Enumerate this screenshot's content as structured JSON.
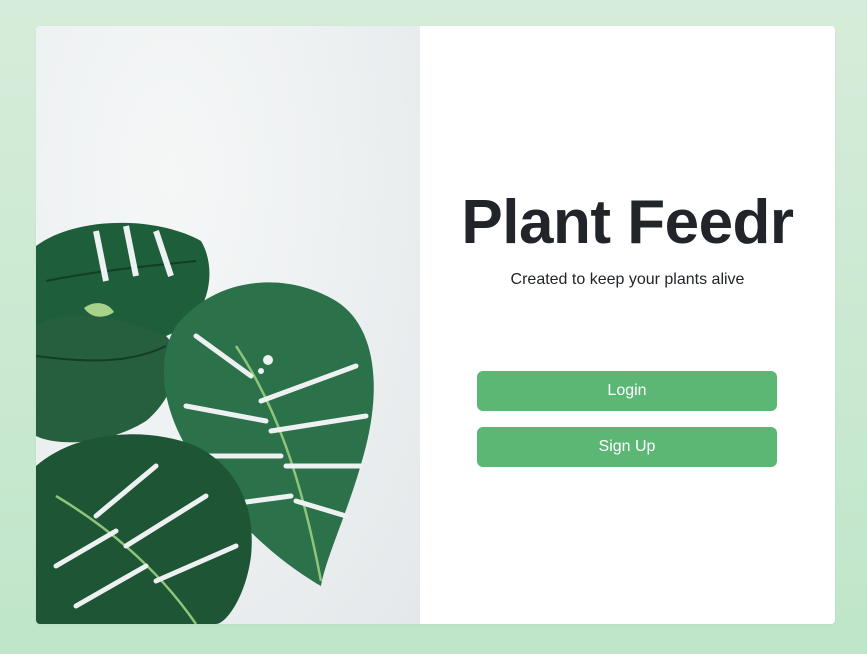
{
  "app": {
    "title": "Plant Feedr",
    "subtitle": "Created to keep your plants alive"
  },
  "actions": {
    "login_label": "Login",
    "signup_label": "Sign Up"
  },
  "hero_image": {
    "subject": "monstera-plant-leaves"
  },
  "colors": {
    "page_background": "#c9e9d0",
    "button_background": "#5cb774",
    "button_text": "#ffffff",
    "title_text": "#212529"
  }
}
